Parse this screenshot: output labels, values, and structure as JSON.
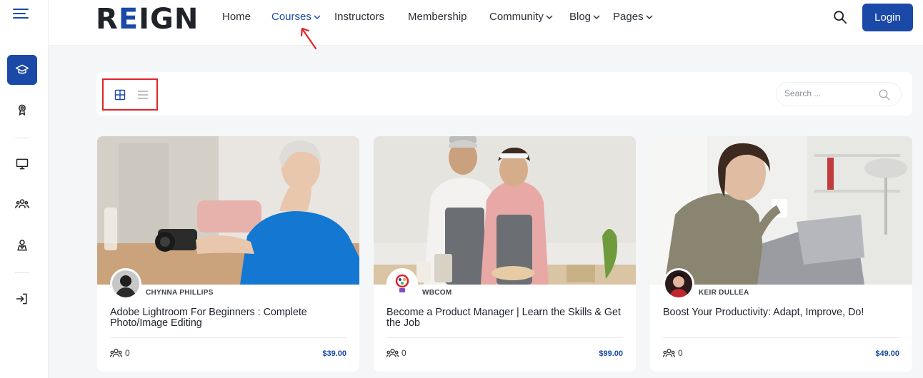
{
  "brand": {
    "logo_text_pre": "R",
    "logo_text_e": "E",
    "logo_text_post": "IGN"
  },
  "sidebar": {
    "menu_icon": "hamburger-icon",
    "items": [
      {
        "icon": "graduation-cap-icon",
        "active": true
      },
      {
        "icon": "award-badge-icon",
        "active": false
      },
      {
        "icon": "monitor-icon",
        "active": false
      },
      {
        "icon": "users-icon",
        "active": false
      },
      {
        "icon": "person-icon",
        "active": false
      },
      {
        "icon": "login-icon",
        "active": false
      }
    ]
  },
  "nav": {
    "items": [
      {
        "label": "Home",
        "dropdown": false,
        "active": false
      },
      {
        "label": "Courses",
        "dropdown": true,
        "active": true
      },
      {
        "label": "Instructors",
        "dropdown": false,
        "active": false
      },
      {
        "label": "Membership",
        "dropdown": false,
        "active": false
      },
      {
        "label": "Community",
        "dropdown": true,
        "active": false
      },
      {
        "label": "Blog",
        "dropdown": true,
        "active": false
      },
      {
        "label": "Pages",
        "dropdown": true,
        "active": false
      }
    ],
    "login_label": "Login"
  },
  "toolbar": {
    "grid_view_icon": "grid-view-icon",
    "list_view_icon": "list-view-icon",
    "search_placeholder": "Search ..."
  },
  "courses": [
    {
      "author": "CHYNNA PHILLIPS",
      "title": "Adobe Lightroom For Beginners : Complete Photo/Image Editing",
      "enrolled": "0",
      "price": "$39.00"
    },
    {
      "author": "WBCOM",
      "title": "Become a Product Manager | Learn the Skills & Get the Job",
      "enrolled": "0",
      "price": "$99.00"
    },
    {
      "author": "KEIR DULLEA",
      "title": "Boost Your Productivity: Adapt, Improve, Do!",
      "enrolled": "0",
      "price": "$49.00"
    }
  ],
  "colors": {
    "accent": "#1a49a8",
    "annotation": "#e0222b"
  }
}
